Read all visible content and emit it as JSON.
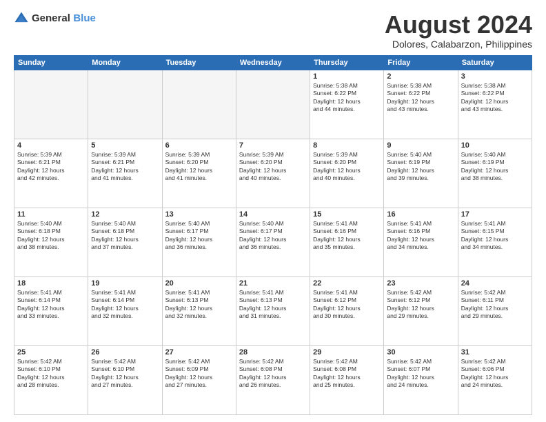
{
  "logo": {
    "general": "General",
    "blue": "Blue"
  },
  "title": "August 2024",
  "location": "Dolores, Calabarzon, Philippines",
  "days_header": [
    "Sunday",
    "Monday",
    "Tuesday",
    "Wednesday",
    "Thursday",
    "Friday",
    "Saturday"
  ],
  "weeks": [
    [
      {
        "day": "",
        "info": ""
      },
      {
        "day": "",
        "info": ""
      },
      {
        "day": "",
        "info": ""
      },
      {
        "day": "",
        "info": ""
      },
      {
        "day": "1",
        "info": "Sunrise: 5:38 AM\nSunset: 6:22 PM\nDaylight: 12 hours\nand 44 minutes."
      },
      {
        "day": "2",
        "info": "Sunrise: 5:38 AM\nSunset: 6:22 PM\nDaylight: 12 hours\nand 43 minutes."
      },
      {
        "day": "3",
        "info": "Sunrise: 5:38 AM\nSunset: 6:22 PM\nDaylight: 12 hours\nand 43 minutes."
      }
    ],
    [
      {
        "day": "4",
        "info": "Sunrise: 5:39 AM\nSunset: 6:21 PM\nDaylight: 12 hours\nand 42 minutes."
      },
      {
        "day": "5",
        "info": "Sunrise: 5:39 AM\nSunset: 6:21 PM\nDaylight: 12 hours\nand 41 minutes."
      },
      {
        "day": "6",
        "info": "Sunrise: 5:39 AM\nSunset: 6:20 PM\nDaylight: 12 hours\nand 41 minutes."
      },
      {
        "day": "7",
        "info": "Sunrise: 5:39 AM\nSunset: 6:20 PM\nDaylight: 12 hours\nand 40 minutes."
      },
      {
        "day": "8",
        "info": "Sunrise: 5:39 AM\nSunset: 6:20 PM\nDaylight: 12 hours\nand 40 minutes."
      },
      {
        "day": "9",
        "info": "Sunrise: 5:40 AM\nSunset: 6:19 PM\nDaylight: 12 hours\nand 39 minutes."
      },
      {
        "day": "10",
        "info": "Sunrise: 5:40 AM\nSunset: 6:19 PM\nDaylight: 12 hours\nand 38 minutes."
      }
    ],
    [
      {
        "day": "11",
        "info": "Sunrise: 5:40 AM\nSunset: 6:18 PM\nDaylight: 12 hours\nand 38 minutes."
      },
      {
        "day": "12",
        "info": "Sunrise: 5:40 AM\nSunset: 6:18 PM\nDaylight: 12 hours\nand 37 minutes."
      },
      {
        "day": "13",
        "info": "Sunrise: 5:40 AM\nSunset: 6:17 PM\nDaylight: 12 hours\nand 36 minutes."
      },
      {
        "day": "14",
        "info": "Sunrise: 5:40 AM\nSunset: 6:17 PM\nDaylight: 12 hours\nand 36 minutes."
      },
      {
        "day": "15",
        "info": "Sunrise: 5:41 AM\nSunset: 6:16 PM\nDaylight: 12 hours\nand 35 minutes."
      },
      {
        "day": "16",
        "info": "Sunrise: 5:41 AM\nSunset: 6:16 PM\nDaylight: 12 hours\nand 34 minutes."
      },
      {
        "day": "17",
        "info": "Sunrise: 5:41 AM\nSunset: 6:15 PM\nDaylight: 12 hours\nand 34 minutes."
      }
    ],
    [
      {
        "day": "18",
        "info": "Sunrise: 5:41 AM\nSunset: 6:14 PM\nDaylight: 12 hours\nand 33 minutes."
      },
      {
        "day": "19",
        "info": "Sunrise: 5:41 AM\nSunset: 6:14 PM\nDaylight: 12 hours\nand 32 minutes."
      },
      {
        "day": "20",
        "info": "Sunrise: 5:41 AM\nSunset: 6:13 PM\nDaylight: 12 hours\nand 32 minutes."
      },
      {
        "day": "21",
        "info": "Sunrise: 5:41 AM\nSunset: 6:13 PM\nDaylight: 12 hours\nand 31 minutes."
      },
      {
        "day": "22",
        "info": "Sunrise: 5:41 AM\nSunset: 6:12 PM\nDaylight: 12 hours\nand 30 minutes."
      },
      {
        "day": "23",
        "info": "Sunrise: 5:42 AM\nSunset: 6:12 PM\nDaylight: 12 hours\nand 29 minutes."
      },
      {
        "day": "24",
        "info": "Sunrise: 5:42 AM\nSunset: 6:11 PM\nDaylight: 12 hours\nand 29 minutes."
      }
    ],
    [
      {
        "day": "25",
        "info": "Sunrise: 5:42 AM\nSunset: 6:10 PM\nDaylight: 12 hours\nand 28 minutes."
      },
      {
        "day": "26",
        "info": "Sunrise: 5:42 AM\nSunset: 6:10 PM\nDaylight: 12 hours\nand 27 minutes."
      },
      {
        "day": "27",
        "info": "Sunrise: 5:42 AM\nSunset: 6:09 PM\nDaylight: 12 hours\nand 27 minutes."
      },
      {
        "day": "28",
        "info": "Sunrise: 5:42 AM\nSunset: 6:08 PM\nDaylight: 12 hours\nand 26 minutes."
      },
      {
        "day": "29",
        "info": "Sunrise: 5:42 AM\nSunset: 6:08 PM\nDaylight: 12 hours\nand 25 minutes."
      },
      {
        "day": "30",
        "info": "Sunrise: 5:42 AM\nSunset: 6:07 PM\nDaylight: 12 hours\nand 24 minutes."
      },
      {
        "day": "31",
        "info": "Sunrise: 5:42 AM\nSunset: 6:06 PM\nDaylight: 12 hours\nand 24 minutes."
      }
    ]
  ]
}
